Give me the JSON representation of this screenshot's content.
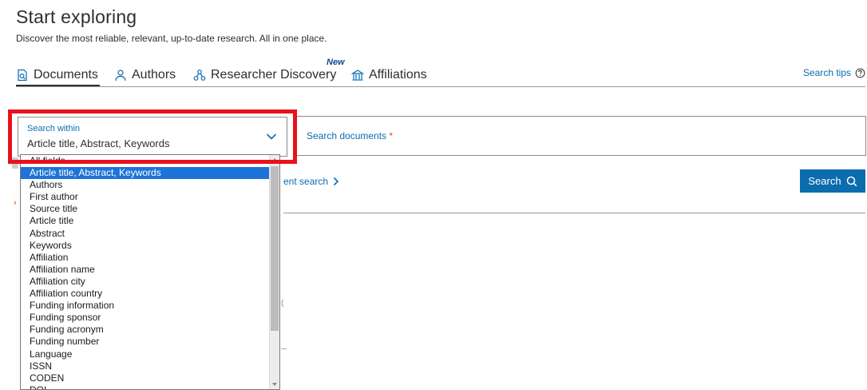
{
  "header": {
    "title": "Start exploring",
    "subtitle": "Discover the most reliable, relevant, up-to-date research. All in one place."
  },
  "tabs": [
    {
      "label": "Documents",
      "icon": "documents-search-icon",
      "active": true
    },
    {
      "label": "Authors",
      "icon": "person-icon",
      "active": false
    },
    {
      "label": "Researcher Discovery",
      "icon": "network-icon",
      "active": false,
      "badge": "New"
    },
    {
      "label": "Affiliations",
      "icon": "institution-icon",
      "active": false
    }
  ],
  "search_tips": {
    "label": "Search tips",
    "icon": "help-circle-icon"
  },
  "search_within": {
    "label": "Search within",
    "value": "Article title, Abstract, Keywords",
    "options": [
      "All fields",
      "Article title, Abstract, Keywords",
      "Authors",
      "First author",
      "Source title",
      "Article title",
      "Abstract",
      "Keywords",
      "Affiliation",
      "Affiliation name",
      "Affiliation city",
      "Affiliation country",
      "Funding information",
      "Funding sponsor",
      "Funding acronym",
      "Funding number",
      "Language",
      "ISSN",
      "CODEN",
      "DOI"
    ],
    "selected_index": 1
  },
  "search_documents": {
    "placeholder": "Search documents",
    "required_mark": "*"
  },
  "advanced_search": {
    "label": "ent search"
  },
  "search_button": {
    "label": "Search",
    "icon": "search-icon"
  },
  "colors": {
    "accent": "#0b6cae",
    "highlight": "#e8121c",
    "selected": "#1e73d8",
    "required": "#e04a2a"
  }
}
